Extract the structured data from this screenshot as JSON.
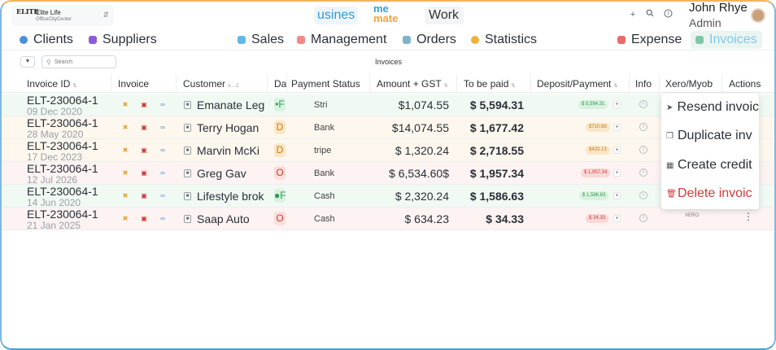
{
  "header": {
    "org_name": "Elite Life",
    "org_sub": "OfficeCityCenter",
    "org_logo": "ELITE",
    "app_tabs": {
      "business": "usines",
      "work": "Work"
    },
    "brand": {
      "line1": "me",
      "line2": "mate"
    },
    "icons": [
      "plus-icon",
      "search-icon",
      "help-icon"
    ],
    "user_name": "John Rhye",
    "user_role": "Admin"
  },
  "nav": {
    "items": [
      {
        "label": "Clients",
        "color": "#4a90d9"
      },
      {
        "label": "Suppliers",
        "color": "#8e5bd6"
      },
      {
        "label": "Sales",
        "color": "#5fb8e6"
      },
      {
        "label": "Management",
        "color": "#f28a8a"
      },
      {
        "label": "Orders",
        "color": "#7fb3c9"
      },
      {
        "label": "Statistics",
        "color": "#f2b03a"
      },
      {
        "label": "Expense",
        "color": "#e86a6a"
      },
      {
        "label": "Invoices",
        "color": "#7fc7a8"
      }
    ]
  },
  "toolbar": {
    "search_placeholder": "Search",
    "caption": "Invoices"
  },
  "table": {
    "columns": [
      "Invoice ID",
      "Invoice",
      "Customer",
      "Da",
      "Payment Status",
      "Amount + GST",
      "To be paid",
      "Deposit/Payment",
      "Info",
      "Xero/Myob",
      "Actions"
    ],
    "sort_glyphs": {
      "invoice_id": "⇅",
      "customer": "A→Z",
      "amount": "⇅",
      "to_be_paid": "⇅",
      "deposit": "⇅"
    },
    "rows": [
      {
        "id": "ELT-230064-1",
        "date": "09 Dec 2020",
        "customer": "Emanate Leg",
        "badge": "•F",
        "status": "Stri",
        "amount": "$1,074.55",
        "to_be_paid": "$ 5,594.31",
        "deposit": "$ 5,594.31",
        "tone": "green"
      },
      {
        "id": "ELT-230064-1",
        "date": "28 May 2020",
        "customer": "Terry Hogan",
        "badge": "D",
        "status": "Bank",
        "amount": "$14,074.55",
        "to_be_paid": "$ 1,677.42",
        "deposit": "$710.68",
        "tone": "orange"
      },
      {
        "id": "ELT-230064-1",
        "date": "17 Dec 2023",
        "customer": "Marvin McKi",
        "badge": "D",
        "status": "tripe",
        "amount": "$ 1,320.24",
        "to_be_paid": "$ 2,718.55",
        "deposit": "$420.13",
        "tone": "orange"
      },
      {
        "id": "ELT-230064-1",
        "date": "12 Jul 2026",
        "customer": "Greg Gav",
        "badge": "O",
        "status": "Bank",
        "amount": "$ 6,534.60$",
        "to_be_paid": "$ 1,957.34",
        "deposit": "$ 1,957.34",
        "tone": "red"
      },
      {
        "id": "ELT-230064-1",
        "date": "14 Jun 2020",
        "customer": "Lifestyle brok",
        "badge": "●F",
        "status": "Cash",
        "amount": "$ 2,320.24",
        "to_be_paid": "$ 1,586.63",
        "deposit": "$ 1,586.63",
        "tone": "green"
      },
      {
        "id": "ELT-230064-1",
        "date": "21 Jan 2025",
        "customer": "Saap Auto",
        "badge": "O",
        "status": "Cash",
        "amount": "$ 634.23",
        "to_be_paid": "$ 34.33",
        "deposit": "$ 34.33",
        "tone": "red"
      }
    ]
  },
  "action_menu": {
    "items": [
      {
        "label": "Resend invoic",
        "icon": "send-icon"
      },
      {
        "label": "Duplicate inv",
        "icon": "copy-icon"
      },
      {
        "label": "Create credit",
        "icon": "calculator-icon"
      },
      {
        "label": "Delete invoic",
        "icon": "trash-icon"
      }
    ]
  },
  "xero_tag": "XERO",
  "colors": {
    "green_row": "#f1f9f3",
    "orange_row": "#fdf7ee",
    "red_row": "#fcf3f2",
    "green_pill_bg": "#d9f2df",
    "green_pill_fg": "#2e9a4d",
    "orange_pill_bg": "#fbe6c9",
    "orange_pill_fg": "#c97a15",
    "red_pill_bg": "#f9d8d6",
    "red_pill_fg": "#d23b35",
    "danger": "#d23b35"
  }
}
